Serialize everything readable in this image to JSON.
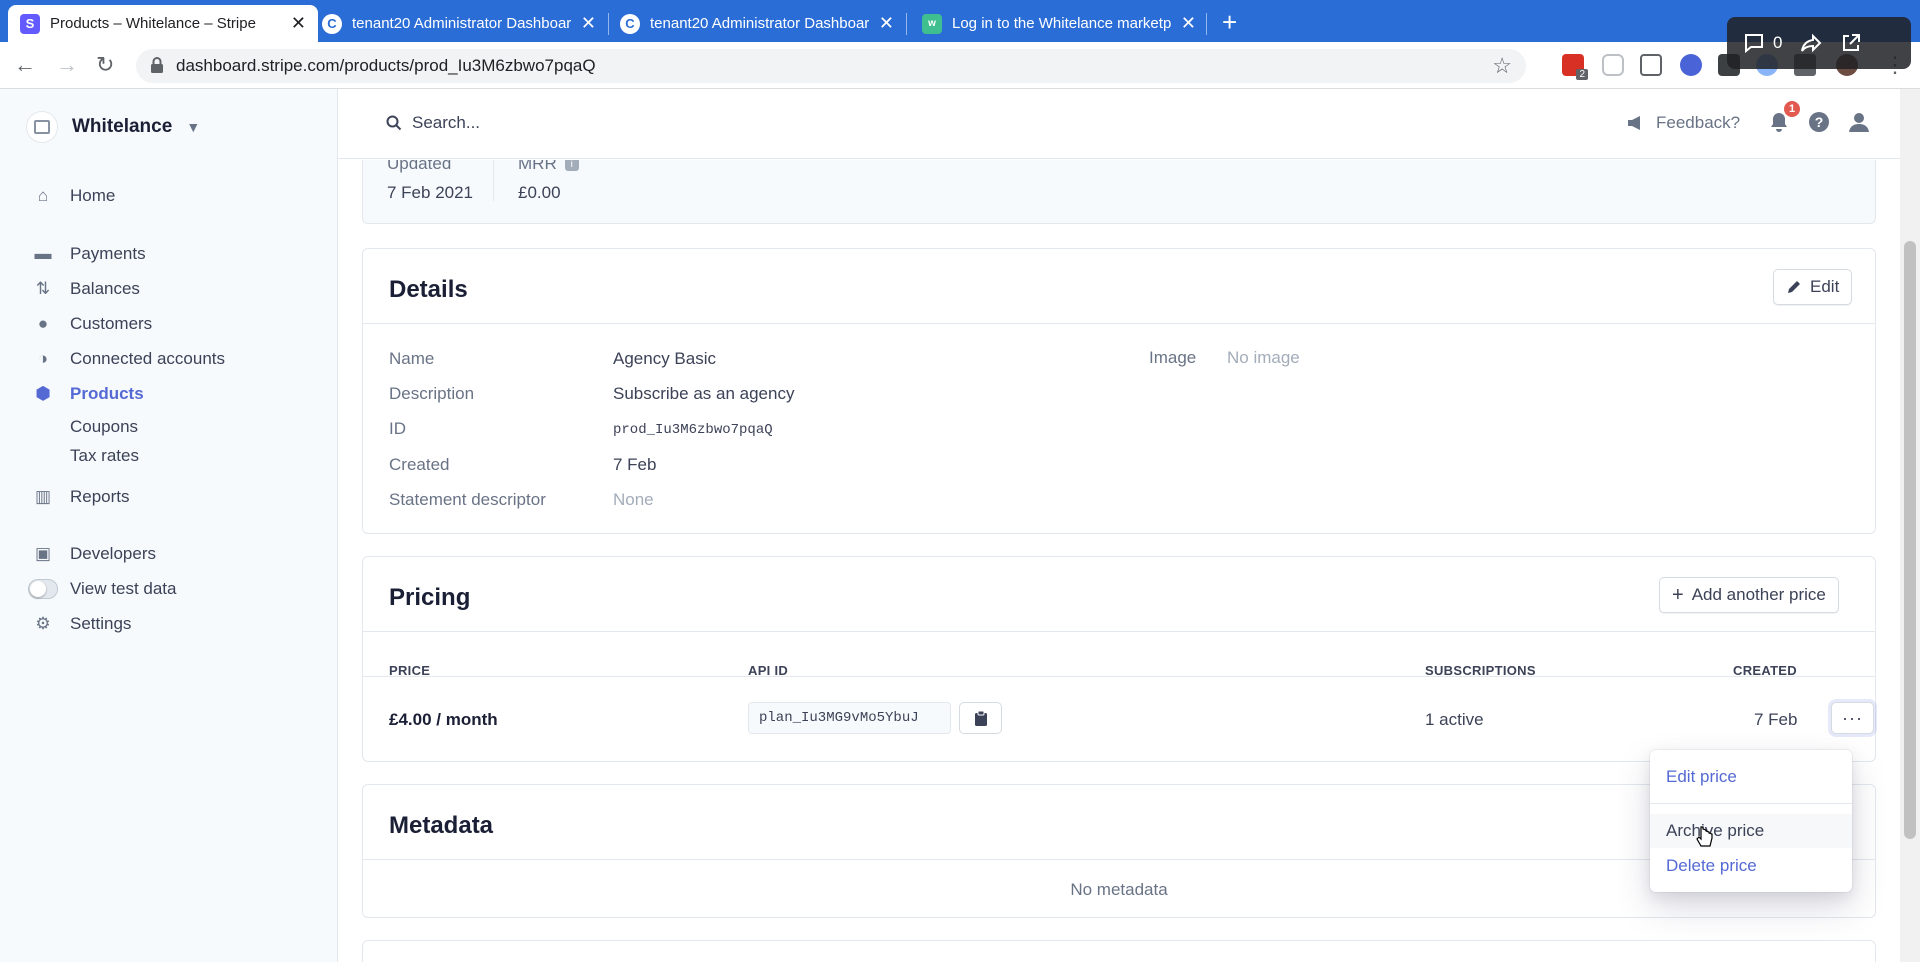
{
  "browser": {
    "tabs": [
      {
        "title": "Products – Whitelance – Stripe",
        "active": true
      },
      {
        "title": "tenant20 Administrator Dashboard",
        "active": false
      },
      {
        "title": "tenant20 Administrator Dashboard",
        "active": false
      },
      {
        "title": "Log in to the Whitelance marketplace",
        "active": false
      }
    ],
    "url": "dashboard.stripe.com/products/prod_Iu3M6zbwo7pqaQ",
    "extension_badge": "2",
    "overlay_count": "0"
  },
  "sidebar": {
    "account_name": "Whitelance",
    "items": [
      {
        "label": "Home",
        "icon": "home-icon"
      },
      {
        "label": "Payments",
        "icon": "payments-icon"
      },
      {
        "label": "Balances",
        "icon": "balances-icon"
      },
      {
        "label": "Customers",
        "icon": "customers-icon"
      },
      {
        "label": "Connected accounts",
        "icon": "connected-accounts-icon"
      },
      {
        "label": "Products",
        "icon": "products-icon"
      },
      {
        "label": "Reports",
        "icon": "reports-icon"
      },
      {
        "label": "Developers",
        "icon": "developers-icon"
      },
      {
        "label": "View test data",
        "icon": "toggle"
      },
      {
        "label": "Settings",
        "icon": "gear-icon"
      }
    ],
    "sub_items": [
      "Coupons",
      "Tax rates"
    ]
  },
  "topbar": {
    "search_placeholder": "Search...",
    "feedback_label": "Feedback?",
    "notification_count": "1"
  },
  "summary": {
    "updated_label": "Updated",
    "updated_value": "7 Feb 2021",
    "mrr_label": "MRR",
    "mrr_value": "£0.00"
  },
  "details": {
    "title": "Details",
    "edit_label": "Edit",
    "fields": [
      {
        "label": "Name",
        "value": "Agency Basic"
      },
      {
        "label": "Description",
        "value": "Subscribe as an agency"
      },
      {
        "label": "ID",
        "value": "prod_Iu3M6zbwo7pqaQ"
      },
      {
        "label": "Created",
        "value": "7 Feb"
      },
      {
        "label": "Statement descriptor",
        "value": "None"
      }
    ],
    "image_label": "Image",
    "image_value": "No image"
  },
  "pricing": {
    "title": "Pricing",
    "add_label": "Add another price",
    "columns": [
      "PRICE",
      "API ID",
      "SUBSCRIPTIONS",
      "CREATED"
    ],
    "rows": [
      {
        "price": "£4.00 / month",
        "api_id": "plan_Iu3MG9vMo5YbuJ",
        "subscriptions": "1 active",
        "created": "7 Feb"
      }
    ]
  },
  "metadata": {
    "title": "Metadata",
    "empty": "No metadata"
  },
  "row_menu": {
    "items": [
      "Edit price",
      "Archive price",
      "Delete price"
    ]
  },
  "colors": {
    "accent": "#5469d4",
    "chrome_blue": "#2b6dd6"
  }
}
